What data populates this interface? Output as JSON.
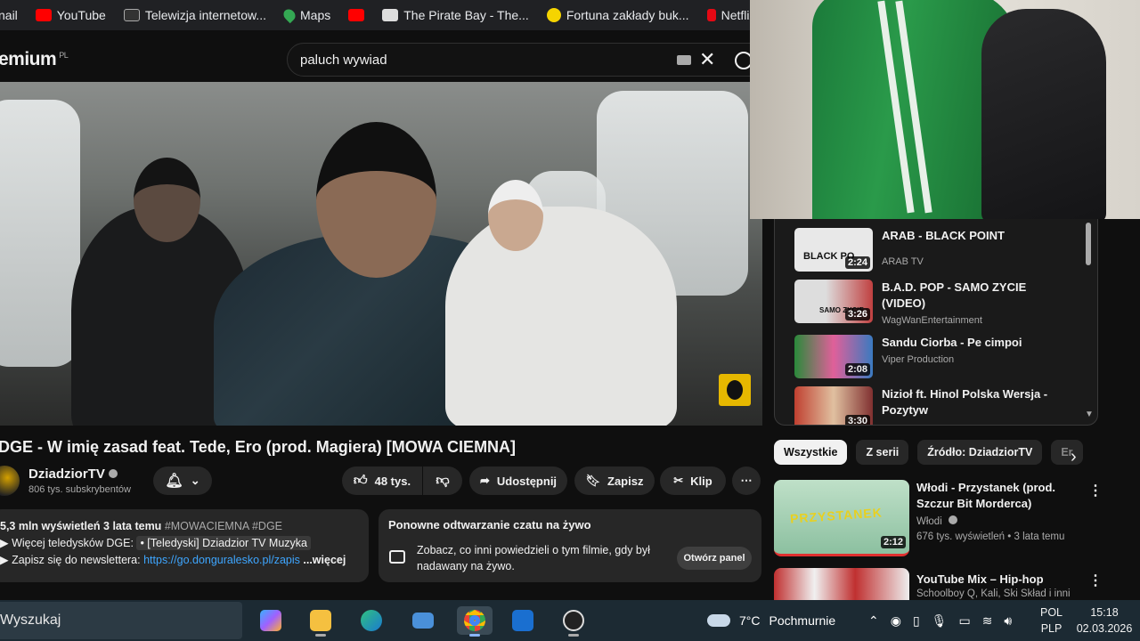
{
  "bookmarks": [
    {
      "label": "nail",
      "color": "#ea4335"
    },
    {
      "label": "YouTube",
      "color": "#ff0000"
    },
    {
      "label": "Telewizja internetow...",
      "color": "#333333"
    },
    {
      "label": "Maps",
      "color": "#34a853"
    },
    {
      "label": "",
      "color": "#ff0000"
    },
    {
      "label": "The Pirate Bay - The...",
      "color": "#dddddd"
    },
    {
      "label": "Fortuna zakłady buk...",
      "color": "#f5d400"
    },
    {
      "label": "Netflix",
      "color": "#e50914"
    }
  ],
  "header": {
    "logo": "emium",
    "logo_region": "PL",
    "search_value": "paluch wywiad"
  },
  "video": {
    "title": "DGE - W imię zasad feat. Tede, Ero (prod. Magiera) [MOWA CIEMNA]",
    "channel": "DziadziorTV",
    "subscribers": "806 tys. subskrybentów",
    "likes": "48 tys.",
    "share": "Udostępnij",
    "save": "Zapisz",
    "clip": "Klip"
  },
  "description": {
    "stats": "5,3 mln wyświetleń  3 lata temu",
    "hashtags": "#MOWACIEMNA #DGE",
    "line2_prefix": "Więcej teledysków DGE:",
    "line2_link": "• [Teledyski] Dziadzior TV Muzyka",
    "line3_prefix": "Zapisz się do newslettera:",
    "line3_link": "https://go.donguralesko.pl/zapis",
    "more": "...więcej"
  },
  "chat_replay": {
    "heading": "Ponowne odtwarzanie czatu na żywo",
    "text": "Zobacz, co inni powiedzieli o tym filmie, gdy był nadawany na żywo.",
    "button": "Otwórz panel"
  },
  "playlist": [
    {
      "title": "ARAB - BLACK POINT",
      "channel": "ARAB TV",
      "duration": "2:24",
      "thumb_text": "BLACK PO"
    },
    {
      "title": "B.A.D. POP - SAMO ZYCIE (VIDEO)",
      "channel": "WagWanEntertainment",
      "duration": "3:26",
      "thumb_text": "SAMO ZYCIE"
    },
    {
      "title": "Sandu Ciorba - Pe cimpoi",
      "channel": "Viper Production",
      "duration": "2:08",
      "thumb_text": ""
    },
    {
      "title": "Nizioł ft. Hinol Polska Wersja - Pozytyw",
      "channel": "",
      "duration": "3:30",
      "thumb_text": ""
    }
  ],
  "chips": [
    "Wszystkie",
    "Z serii",
    "Źródło: DziadziorTV",
    "Er"
  ],
  "recommendations": [
    {
      "title": "Włodi - Przystanek (prod. Szczur Bit Morderca)",
      "channel": "Włodi",
      "meta": "676 tys. wyświetleń • 3 lata temu",
      "duration": "2:12",
      "thumb_text": "PRZYSTANEK"
    },
    {
      "title": "YouTube Mix – Hip-hop",
      "channel": "Schoolboy Q, Kali, Ski Skład i inni",
      "meta": "",
      "duration": "",
      "thumb_text": ""
    }
  ],
  "taskbar": {
    "search": "Wyszukaj",
    "weather_temp": "7°C",
    "weather_desc": "Pochmurnie",
    "lang_top": "POL",
    "lang_bottom": "PLP",
    "time": "15:18",
    "date": "02.03.2026"
  }
}
